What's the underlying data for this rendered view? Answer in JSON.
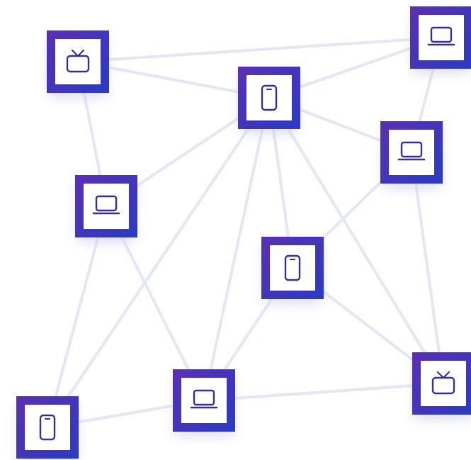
{
  "colors": {
    "frame_start": "#5b2fb3",
    "frame_end": "#2a3bc4",
    "inner": "#ffffff",
    "icon": "#3a2f8e",
    "edge": "#e3e6f3",
    "shadow": "#c9ccec"
  },
  "nodes": [
    {
      "id": "n1",
      "icon": "tv-icon"
    },
    {
      "id": "n2",
      "icon": "smartphone-icon"
    },
    {
      "id": "n3",
      "icon": "laptop-icon"
    },
    {
      "id": "n4",
      "icon": "laptop-icon"
    },
    {
      "id": "n5",
      "icon": "laptop-icon"
    },
    {
      "id": "n6",
      "icon": "smartphone-icon"
    },
    {
      "id": "n7",
      "icon": "tv-icon"
    },
    {
      "id": "n8",
      "icon": "laptop-icon"
    },
    {
      "id": "n9",
      "icon": "smartphone-icon"
    }
  ],
  "edges": [
    [
      "n1",
      "n3"
    ],
    [
      "n1",
      "n2"
    ],
    [
      "n1",
      "n5"
    ],
    [
      "n2",
      "n3"
    ],
    [
      "n3",
      "n4"
    ],
    [
      "n2",
      "n4"
    ],
    [
      "n2",
      "n5"
    ],
    [
      "n2",
      "n6"
    ],
    [
      "n2",
      "n8"
    ],
    [
      "n2",
      "n7"
    ],
    [
      "n2",
      "n9"
    ],
    [
      "n4",
      "n6"
    ],
    [
      "n4",
      "n7"
    ],
    [
      "n5",
      "n8"
    ],
    [
      "n5",
      "n9"
    ],
    [
      "n6",
      "n8"
    ],
    [
      "n6",
      "n7"
    ],
    [
      "n8",
      "n7"
    ],
    [
      "n8",
      "n9"
    ]
  ]
}
